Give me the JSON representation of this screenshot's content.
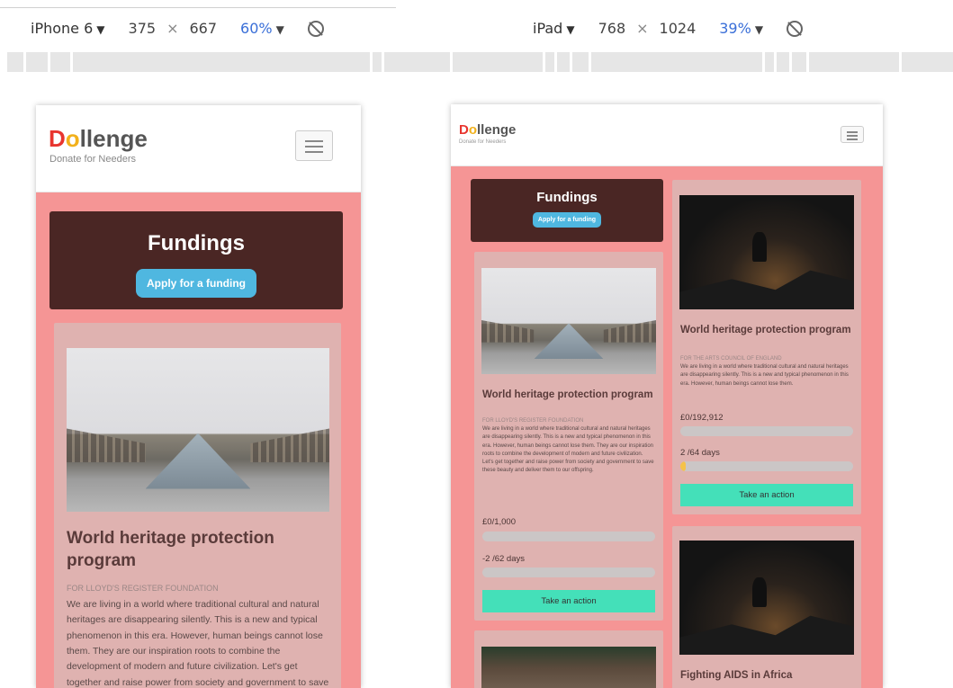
{
  "devices": [
    {
      "name": "iPhone 6",
      "width": "375",
      "height": "667",
      "zoom": "60%"
    },
    {
      "name": "iPad",
      "width": "768",
      "height": "1024",
      "zoom": "39%"
    }
  ],
  "symbols": {
    "caret": "▼",
    "times": "×"
  },
  "brand": {
    "logo_d": "D",
    "logo_o": "o",
    "logo_rest": "llenge",
    "tagline": "Donate for Needers"
  },
  "fundings": {
    "title": "Fundings",
    "apply_label": "Apply for a funding"
  },
  "cards": [
    {
      "title": "World heritage protection program",
      "org": "for LLOYD'S REGISTER FOUNDATION",
      "description": "We are living in a world where traditional cultural and natural heritages are disappearing silently. This is a new and typical phenomenon in this era. However, human beings cannot lose them. They are our inspiration roots to combine the development of modern and future civilization. Let's get together and raise power from society and government to save these beauty and deliver them to our offspring.",
      "amount": "£0/1,000",
      "days": "-2 /62 days",
      "progress_amount": 0,
      "progress_days": 0,
      "action": "Take an action",
      "image": "louvre-pyramid"
    },
    {
      "title": "World heritage protection program",
      "org": "for THE ARTS COUNCIL OF ENGLAND",
      "description": "We are living in a world where traditional cultural and natural heritages are disappearing silently. This is a new and typical phenomenon in this era. However, human beings cannot lose them.",
      "amount": "£0/192,912",
      "days": "2 /64 days",
      "progress_amount": 0,
      "progress_days": 0.03,
      "action": "Take an action",
      "image": "dark-sunset-silhouette"
    },
    {
      "title": "Fighting AIDS in Africa",
      "image": "dark-sunset-silhouette"
    },
    {
      "image": "outdoor-building"
    }
  ],
  "colors": {
    "page_bg": "#f59595",
    "fund_box": "#4a2624",
    "apply": "#4fb7e0",
    "card": "#dfb2b0",
    "action": "#44e0b9",
    "zoom_text": "#3a6fd8"
  }
}
